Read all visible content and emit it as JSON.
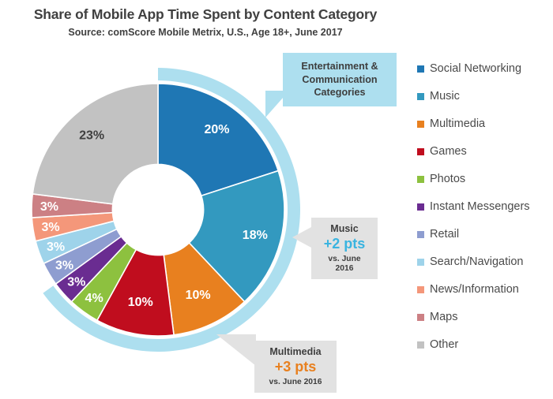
{
  "header": {
    "title": "Share of Mobile App Time Spent by Content Category",
    "subtitle": "Source: comScore Mobile Metrix, U.S., Age 18+, June 2017"
  },
  "chart_data": {
    "type": "pie",
    "title": "Share of Mobile App Time Spent by Content Category",
    "subtitle": "Source: comScore Mobile Metrix, U.S., Age 18+, June 2017",
    "donut": true,
    "inner_radius_ratio": 0.36,
    "start_angle_deg": 0,
    "direction": "clockwise",
    "legend_position": "right",
    "categories": [
      "Social Networking",
      "Music",
      "Multimedia",
      "Games",
      "Photos",
      "Instant Messengers",
      "Retail",
      "Search/Navigation",
      "News/Information",
      "Maps",
      "Other"
    ],
    "values": [
      20,
      18,
      10,
      10,
      4,
      3,
      3,
      3,
      3,
      3,
      23
    ],
    "value_labels": [
      "20%",
      "18%",
      "10%",
      "10%",
      "4%",
      "3%",
      "3%",
      "3%",
      "3%",
      "3%",
      "23%"
    ],
    "colors": [
      "#1f77b4",
      "#3399bf",
      "#e8801f",
      "#c00d1e",
      "#8dc13f",
      "#6a2c91",
      "#8e9dd0",
      "#9ed3ea",
      "#f4977a",
      "#cc8084",
      "#c2c2c2"
    ],
    "label_text_colors": [
      "#ffffff",
      "#ffffff",
      "#ffffff",
      "#ffffff",
      "#ffffff",
      "#ffffff",
      "#ffffff",
      "#ffffff",
      "#ffffff",
      "#ffffff",
      "#404040"
    ],
    "highlight_ring": {
      "label": "Entertainment & Communication Categories",
      "color": "#addfef",
      "covers": [
        "Social Networking",
        "Music",
        "Multimedia",
        "Games",
        "Photos",
        "Instant Messengers"
      ],
      "start_value": 0,
      "end_value": 65
    },
    "annotations": [
      {
        "category": "Music",
        "title": "Music",
        "delta": "+2 pts",
        "delta_color": "#3ab4e0",
        "note": "vs. June 2016"
      },
      {
        "category": "Multimedia",
        "title": "Multimedia",
        "delta": "+3 pts",
        "delta_color": "#e8801f",
        "note": "vs. June 2016"
      }
    ]
  },
  "legend": {
    "items": [
      {
        "label": "Social Networking",
        "color": "#1f77b4"
      },
      {
        "label": "Music",
        "color": "#3399bf"
      },
      {
        "label": "Multimedia",
        "color": "#e8801f"
      },
      {
        "label": "Games",
        "color": "#c00d1e"
      },
      {
        "label": "Photos",
        "color": "#8dc13f"
      },
      {
        "label": "Instant Messengers",
        "color": "#6a2c91"
      },
      {
        "label": "Retail",
        "color": "#8e9dd0"
      },
      {
        "label": "Search/Navigation",
        "color": "#9ed3ea"
      },
      {
        "label": "News/Information",
        "color": "#f4977a"
      },
      {
        "label": "Maps",
        "color": "#cc8084"
      },
      {
        "label": "Other",
        "color": "#c2c2c2"
      }
    ]
  },
  "callouts": {
    "entertainment": {
      "line1": "Entertainment &",
      "line2": "Communication",
      "line3": "Categories"
    },
    "music": {
      "title": "Music",
      "delta": "+2 pts",
      "note": "vs. June 2016"
    },
    "multimedia": {
      "title": "Multimedia",
      "delta": "+3 pts",
      "note": "vs. June 2016"
    }
  }
}
